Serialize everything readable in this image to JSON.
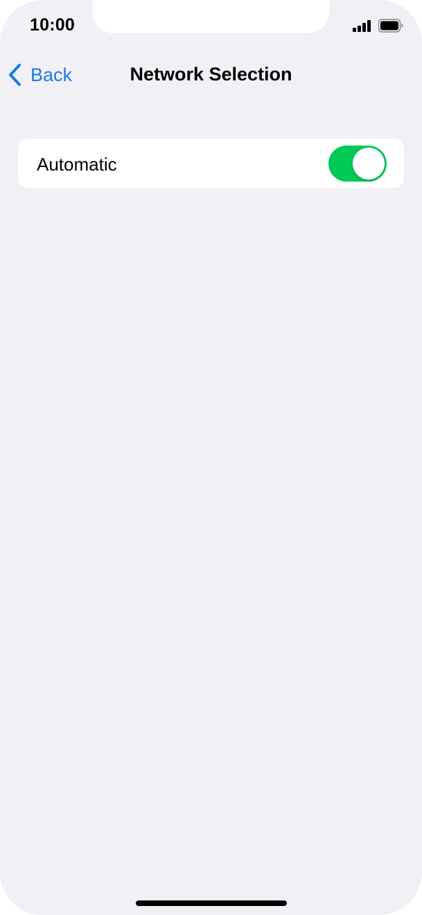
{
  "status_bar": {
    "time": "10:00",
    "signal_icon": "cellular-signal-icon",
    "battery_icon": "battery-icon"
  },
  "nav": {
    "back_label": "Back",
    "title": "Network Selection"
  },
  "settings": {
    "rows": [
      {
        "label": "Automatic",
        "toggle_on": true
      }
    ]
  },
  "colors": {
    "accent": "#1a7ae6",
    "toggle_on": "#00c957",
    "background": "#f0f0f5"
  }
}
